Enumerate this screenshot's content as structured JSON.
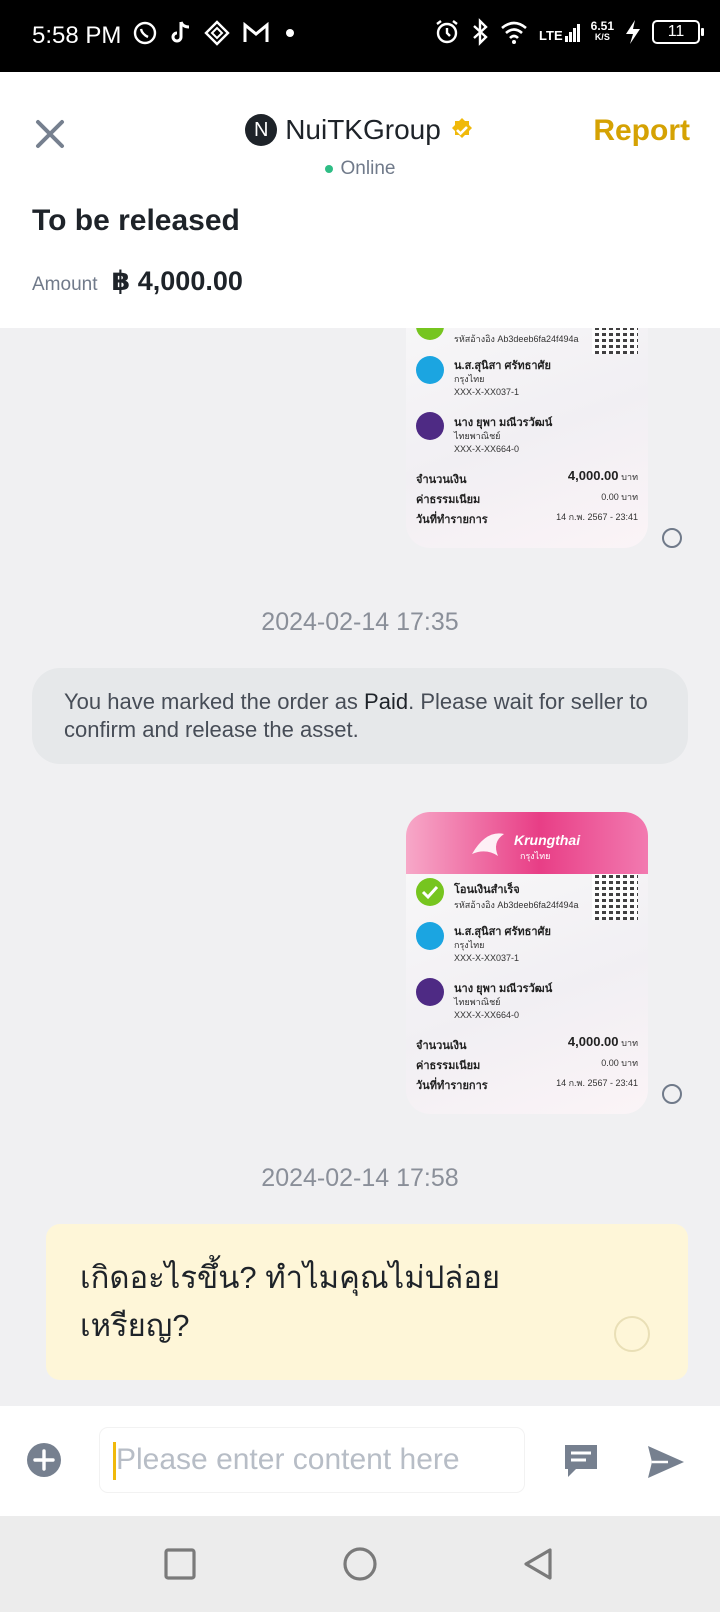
{
  "status_bar": {
    "time": "5:58 PM",
    "network": "LTE",
    "speed_value": "6.51",
    "speed_unit": "K/S",
    "battery": "11",
    "left_icons": [
      "whatsapp-icon",
      "tiktok-icon",
      "app-icon",
      "gmail-icon",
      "dot-icon"
    ],
    "right_icons": [
      "alarm-icon",
      "bluetooth-icon",
      "wifi-icon",
      "signal-icon",
      "charging-icon",
      "battery-icon"
    ]
  },
  "header": {
    "avatar_initial": "N",
    "name": "NuiTKGroup",
    "online_label": "Online",
    "report_label": "Report",
    "title": "To be released",
    "amount_label": "Amount",
    "amount_value": "฿ 4,000.00"
  },
  "slip": {
    "brand": "Krungthai",
    "brand_sub": "กรุงไทย",
    "status": "โอนเงินสำเร็จ",
    "ref": "รหัสอ้างอิง Ab3deeb6fa24f494a",
    "sender_name": "น.ส.สุนิสา ศรัทธาศัย",
    "sender_bank": "กรุงไทย",
    "sender_account": "XXX-X-XX037-1",
    "receiver_name": "นาง ยุพา มณีวรวัฒน์",
    "receiver_bank": "ไทยพาณิชย์",
    "receiver_account": "XXX-X-XX664-0",
    "amount_label": "จำนวนเงิน",
    "amount": "4,000.00",
    "amount_unit": "บาท",
    "fee_label": "ค่าธรรมเนียม",
    "fee": "0.00 บาท",
    "date_label": "วันที่ทำรายการ",
    "date": "14 ก.พ. 2567 - 23:41"
  },
  "chat": {
    "timestamp_1": "2024-02-14 17:35",
    "sys_msg_before": "You have marked the order as ",
    "sys_msg_paid": "Paid",
    "sys_msg_after": ". Please wait for seller to confirm and release the asset.",
    "timestamp_2": "2024-02-14 17:58",
    "my_message": "เกิดอะไรขึ้น? ทำไมคุณไม่ปล่อยเหรียญ?"
  },
  "input": {
    "placeholder": "Please enter content here"
  },
  "colors": {
    "accent": "#f0b90b",
    "report": "#d5a203",
    "online": "#2ebd85",
    "my_bubble": "#fef6d8",
    "system_bubble": "#e6e8ea"
  }
}
